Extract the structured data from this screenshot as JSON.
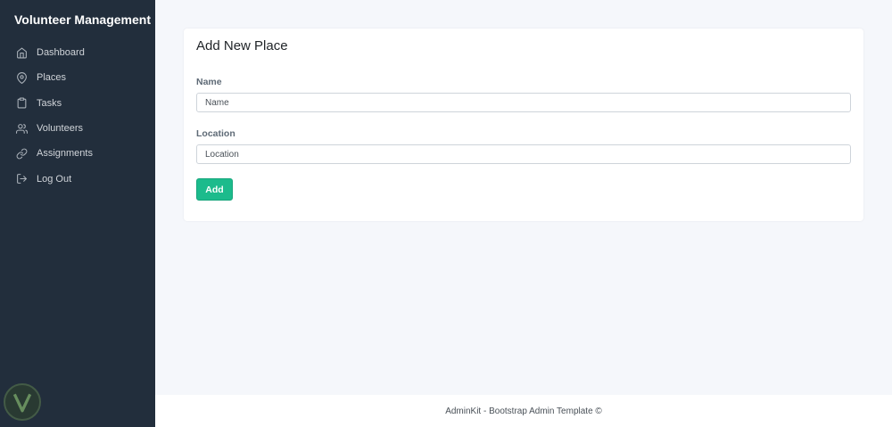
{
  "sidebar": {
    "brand": "Volunteer Management",
    "items": [
      {
        "label": "Dashboard",
        "icon": "home-icon"
      },
      {
        "label": "Places",
        "icon": "map-pin-icon"
      },
      {
        "label": "Tasks",
        "icon": "clipboard-icon"
      },
      {
        "label": "Volunteers",
        "icon": "users-icon"
      },
      {
        "label": "Assignments",
        "icon": "link-icon"
      },
      {
        "label": "Log Out",
        "icon": "log-out-icon"
      }
    ]
  },
  "card": {
    "title": "Add New Place",
    "name_label": "Name",
    "name_placeholder": "Name",
    "location_label": "Location",
    "location_placeholder": "Location",
    "submit_label": "Add"
  },
  "footer": {
    "text": "AdminKit - Bootstrap Admin Template ©"
  },
  "colors": {
    "sidebar_bg": "#222e3c",
    "page_bg": "#f5f7fb",
    "accent": "#1cbb8c"
  }
}
